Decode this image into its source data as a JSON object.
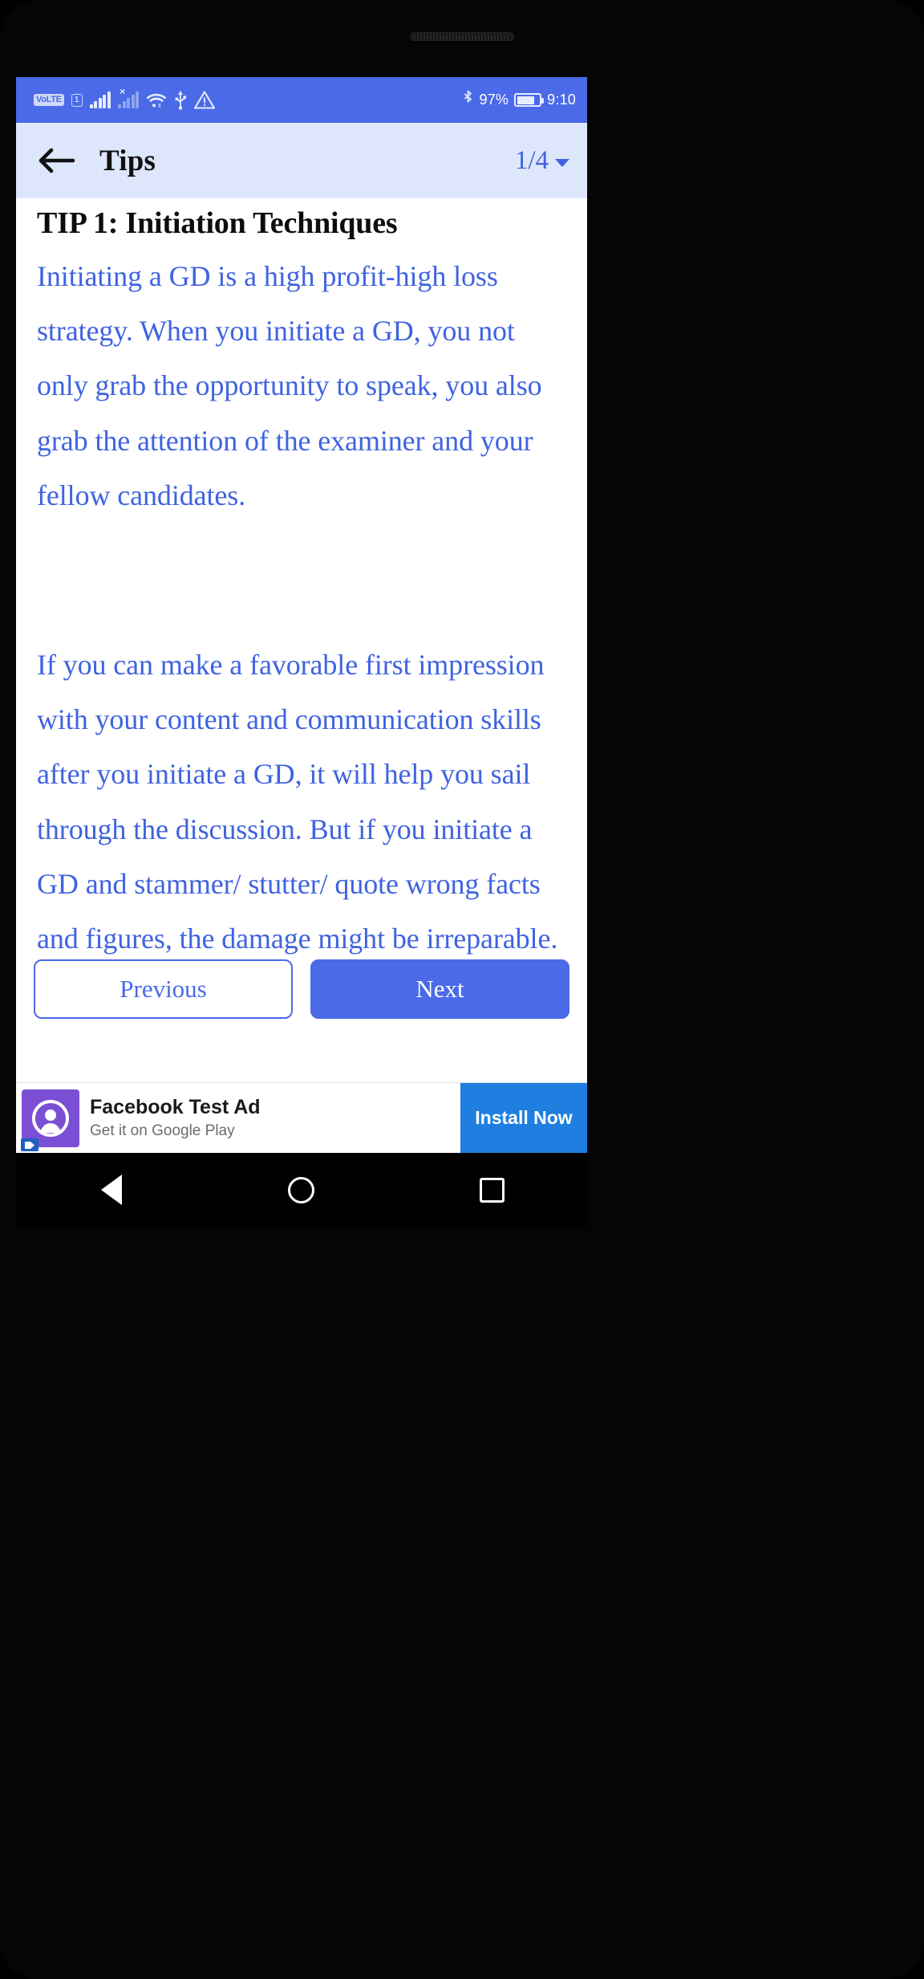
{
  "status_bar": {
    "volte_label": "VoLTE",
    "sim_label": "1",
    "icons": [
      "volte-badge",
      "sim-indicator",
      "signal-bars-sim1",
      "signal-bars-sim2-no-service",
      "wifi-icon",
      "usb-icon",
      "warning-triangle-icon"
    ],
    "bluetooth_icon": "bluetooth-icon",
    "battery_percent": "97%",
    "battery_icon": "battery-icon",
    "time": "9:10",
    "background_color": "#4a6ae8"
  },
  "app_bar": {
    "back_icon": "back-arrow-icon",
    "title": "Tips",
    "page_indicator": "1/4",
    "chevron_icon": "chevron-down-icon",
    "background_color": "#dee6fb"
  },
  "content": {
    "heading": "TIP 1: Initiation Techniques",
    "paragraph_1": "Initiating a GD is a high profit-high loss strategy. When you initiate a GD, you not only grab the opportunity to speak, you also grab the attention of the examiner and your fellow candidates.",
    "paragraph_2": "If you can make a favorable first impression with your content and communication skills after you initiate a GD, it will help you sail through the discussion. But if you initiate a GD and stammer/ stutter/ quote wrong facts and figures, the damage might be irreparable.",
    "text_color": "#3f63e0",
    "heading_color": "#0d0d0d"
  },
  "buttons": {
    "previous_label": "Previous",
    "next_label": "Next",
    "accent_color": "#4a6ae8"
  },
  "ad_banner": {
    "icon": "facebook-messenger-ad-icon",
    "adchoices_icon": "adchoices-icon",
    "title": "Facebook Test Ad",
    "subtitle": "Get it on Google Play",
    "cta_label": "Install Now",
    "cta_color": "#1f7fe0"
  },
  "nav_bar": {
    "back_icon": "nav-back-triangle-icon",
    "home_icon": "nav-home-circle-icon",
    "recents_icon": "nav-recents-square-icon"
  }
}
